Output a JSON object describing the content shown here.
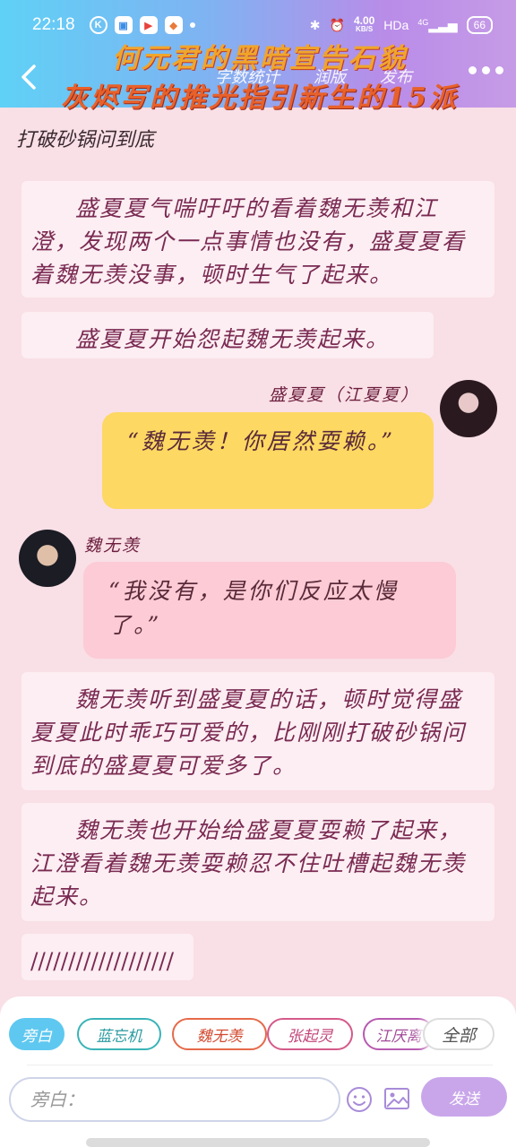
{
  "status_bar": {
    "time": "22:18",
    "net_speed": "4.00",
    "net_unit": "KB/S",
    "hd_label": "HDa",
    "signal_label": "4G",
    "battery": "66"
  },
  "header": {
    "tabs": [
      "字数统计",
      "润版",
      "发布"
    ],
    "banner_line1": "何元君的黑暗宣告石貌",
    "banner_line2": "灰烬写的推光指引新生的15派"
  },
  "content": {
    "chapter_title": "打破砂锅问到底",
    "narration_1": "盛夏夏气喘吁吁的看着魏无羡和江澄，发现两个一点事情也没有，盛夏夏看着魏无羡没事，顿时生气了起来。",
    "narration_2": "盛夏夏开始怨起魏无羡起来。",
    "speaker_1": "盛夏夏（江夏夏）",
    "bubble_1": "“魏无羡！你居然耍赖。”",
    "speaker_2": "魏无羡",
    "bubble_2": "“我没有，是你们反应太慢了。”",
    "narration_3": "魏无羡听到盛夏夏的话，顿时觉得盛夏夏此时乖巧可爱的，比刚刚打破砂锅问到底的盛夏夏可爱多了。",
    "narration_4": "魏无羡也开始给盛夏夏耍赖了起来，江澄看着魏无羡耍赖忍不住吐槽起魏无羡起来。",
    "narration_5": "///////////////////"
  },
  "bottom": {
    "chips": [
      "旁白",
      "蓝忘机",
      "魏无羡",
      "张起灵",
      "江厌离"
    ],
    "all_label": "全部",
    "input_placeholder": "旁白：",
    "send_label": "发送"
  },
  "colors": {
    "header_gradient_start": "#5fd1f6",
    "header_gradient_end": "#c69be6",
    "background": "#f9dfe6",
    "bubble_yellow": "#fdd862",
    "bubble_pink": "#fccbd5",
    "send_button": "#c9a6ea"
  }
}
